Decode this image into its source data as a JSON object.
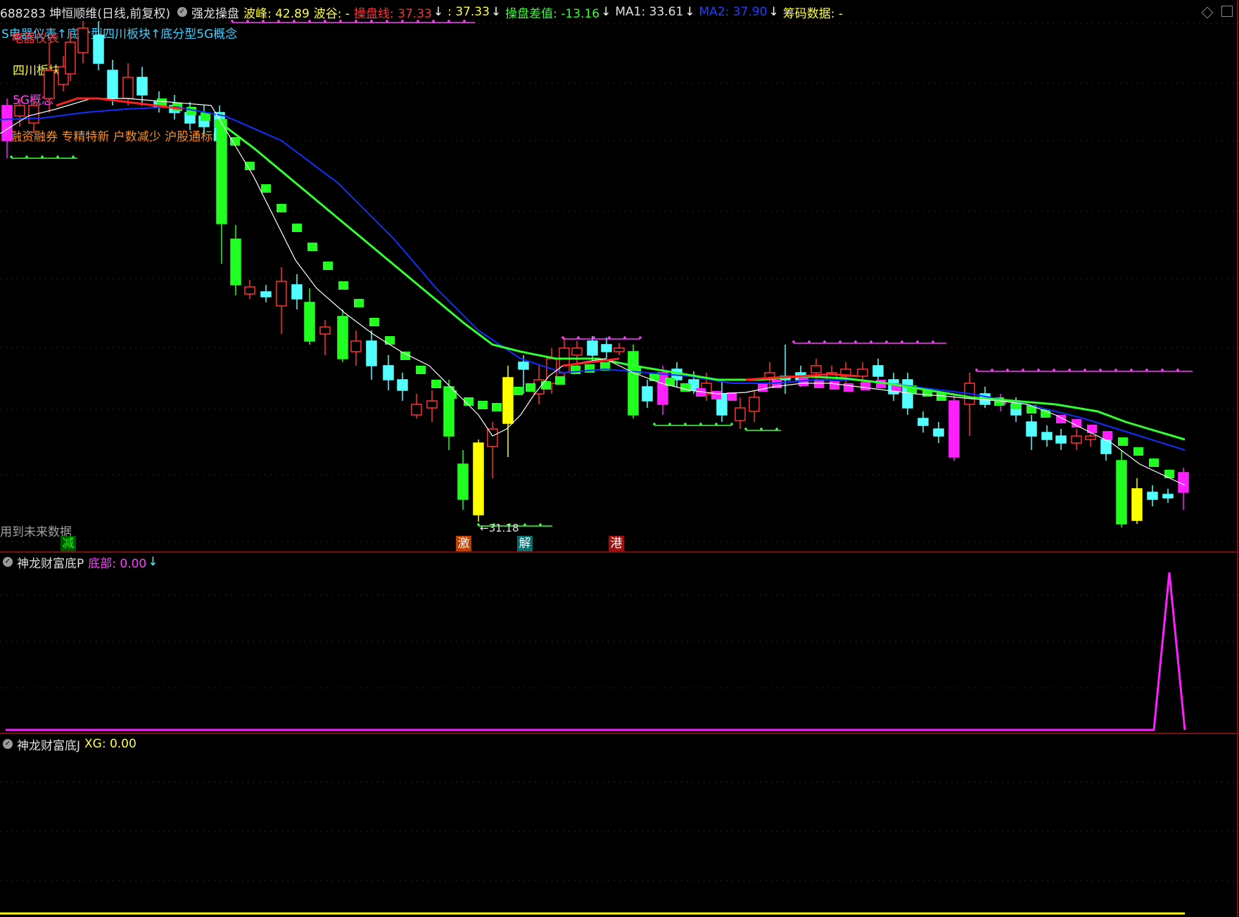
{
  "header": {
    "stock": "688283 坤恒顺维(日线,前复权)",
    "indicator_name": "强龙操盘",
    "wave_peak": "波峰: 42.89",
    "wave_valley": "波谷: -",
    "op_line": "操盘线: 37.33",
    "op_line_arrow": "↓",
    "op_line2": ": 37.33",
    "op_line2_arrow": "↓",
    "op_diff": "操盘差值: -13.16",
    "op_diff_arrow": "↓",
    "ma1": "MA1: 33.61",
    "ma1_arrow": "↓",
    "ma2": "MA2: 37.90",
    "ma2_arrow": "↓",
    "chip_data": "筹码数据: -"
  },
  "concepts": {
    "line1": "S电器仪表↑底分型四川板块↑底分型5G概念",
    "overlay_red": "电器仪表",
    "sichuan": "四川板块",
    "5g": "5G概念",
    "tags": "融资融券 专精特新 户数减少 沪股通标的"
  },
  "main_chart": {
    "future_data_note": "用到未来数据",
    "low_price_label": "←31.18",
    "markers": [
      {
        "text": "减",
        "color": "#00ff00"
      },
      {
        "text": "激",
        "color": "#ff8040"
      },
      {
        "text": "解",
        "color": "#40ffff"
      },
      {
        "text": "港",
        "color": "#ff6060"
      }
    ]
  },
  "panel_p": {
    "title": "神龙财富底P",
    "value": "底部: 0.00",
    "arrow": "↓"
  },
  "panel_j": {
    "title": "神龙财富底J",
    "value": "XG: 0.00"
  },
  "colors": {
    "up": "#ff3030",
    "down": "#54ffff",
    "green_candle": "#20ff20",
    "magenta": "#ff20ff",
    "yellow": "#ffff00",
    "ma_green": "#30ff30",
    "ma_blue": "#1030ff"
  }
}
